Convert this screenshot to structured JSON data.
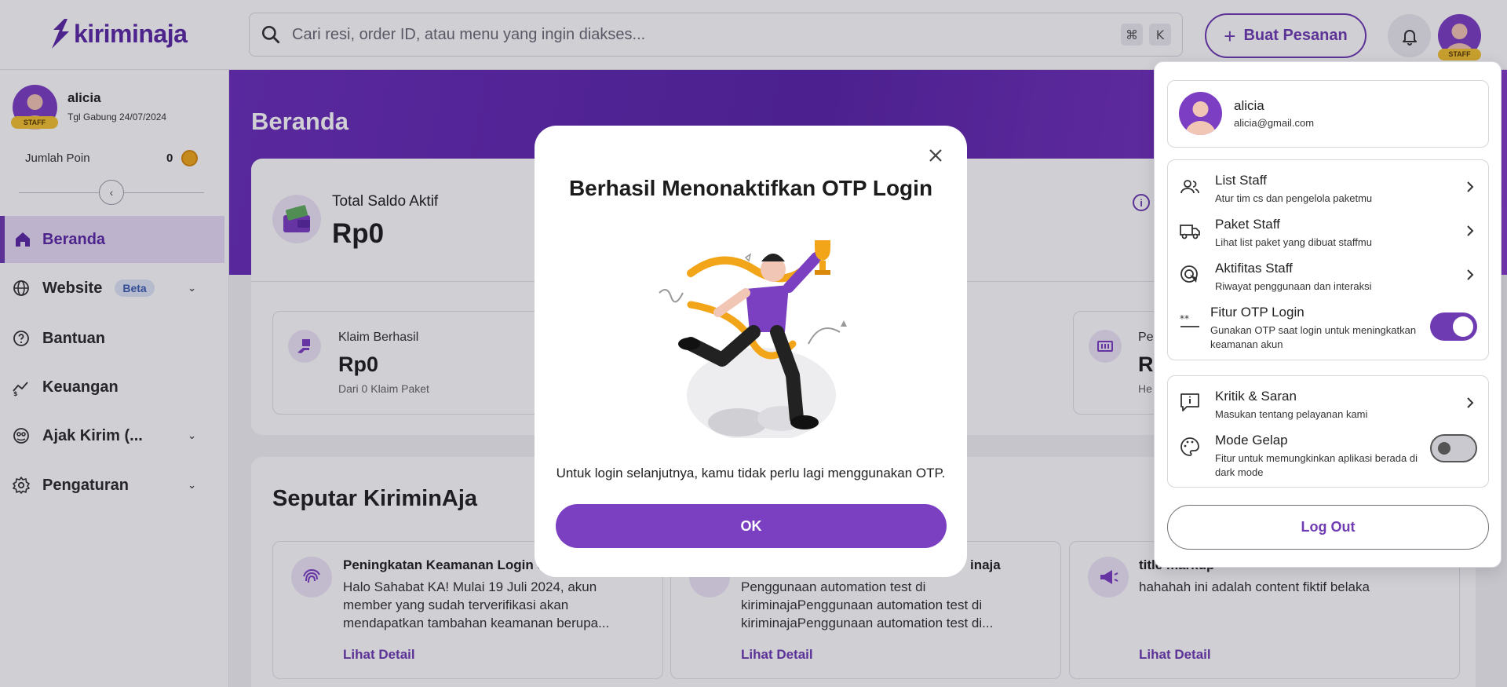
{
  "header": {
    "logo_text": "kiriminaja",
    "search_placeholder": "Cari resi, order ID, atau menu yang ingin diakses...",
    "shortcut_keys": [
      "⌘",
      "K"
    ],
    "create_order_label": "Buat Pesanan",
    "staff_badge": "STAFF"
  },
  "sidebar": {
    "user_name": "alicia",
    "staff_badge": "STAFF",
    "join_date": "Tgl Gabung 24/07/2024",
    "points_label": "Jumlah Poin",
    "points_value": "0",
    "items": [
      {
        "label": "Beranda",
        "icon": "home-icon",
        "active": true
      },
      {
        "label": "Website",
        "icon": "globe-icon",
        "badge": "Beta"
      },
      {
        "label": "Bantuan",
        "icon": "help-icon"
      },
      {
        "label": "Keuangan",
        "icon": "finance-icon"
      },
      {
        "label": "Ajak Kirim (...",
        "icon": "referral-icon"
      },
      {
        "label": "Pengaturan",
        "icon": "settings-icon"
      }
    ]
  },
  "main": {
    "page_title": "Beranda",
    "saldo_label": "Total Saldo Aktif",
    "saldo_value": "Rp0",
    "stats": [
      {
        "label": "Klaim Berhasil",
        "value": "Rp0",
        "sub": "Dari 0 Klaim Paket"
      },
      {
        "label": "Pe",
        "value": "R",
        "sub": "He"
      }
    ],
    "news_title": "Seputar KiriminAja",
    "news": [
      {
        "title": "Peningkatan Keamanan Login de",
        "body": "Halo Sahabat KA! Mulai 19 Juli 2024, akun member yang sudah terverifikasi akan mendapatkan tambahan keamanan berupa...",
        "link": "Lihat Detail"
      },
      {
        "title": "inaja",
        "body": "Penggunaan automation test di kiriminajaPenggunaan automation test di kiriminajaPenggunaan automation test di...",
        "link": "Lihat Detail"
      },
      {
        "title": "title markup",
        "body": "hahahah ini adalah content fiktif belaka",
        "link": "Lihat Detail"
      }
    ]
  },
  "dropdown": {
    "name": "alicia",
    "email": "alicia@gmail.com",
    "items": [
      {
        "title": "List Staff",
        "sub": "Atur tim cs dan pengelola paketmu"
      },
      {
        "title": "Paket Staff",
        "sub": "Lihat list paket yang dibuat staffmu"
      },
      {
        "title": "Aktifitas Staff",
        "sub": "Riwayat penggunaan dan interaksi"
      },
      {
        "title": "Fitur OTP Login",
        "sub": "Gunakan OTP saat login untuk meningkatkan keamanan akun",
        "toggle": true
      },
      {
        "title": "Kritik & Saran",
        "sub": "Masukan tentang pelayanan kami"
      },
      {
        "title": "Mode Gelap",
        "sub": "Fitur untuk memungkinkan aplikasi berada di dark mode",
        "toggle": false
      }
    ],
    "logout_label": "Log Out"
  },
  "modal": {
    "title": "Berhasil Menonaktifkan OTP Login",
    "description": "Untuk login selanjutnya, kamu tidak perlu lagi menggunakan OTP.",
    "ok_label": "OK"
  },
  "colors": {
    "brand": "#6f3bb3",
    "accent_yellow": "#f4c430"
  }
}
